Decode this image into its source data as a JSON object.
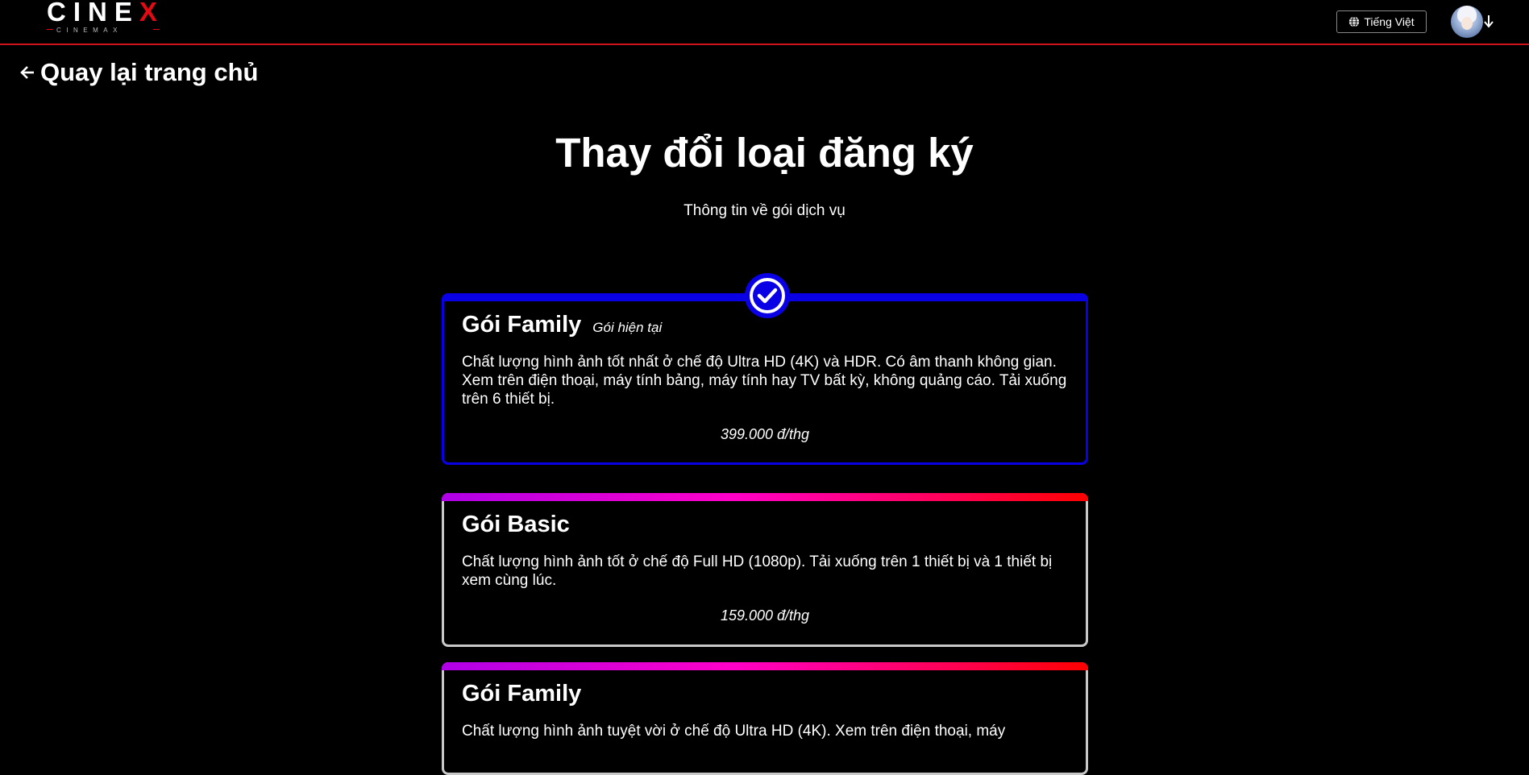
{
  "brand": {
    "name_main": "CINE",
    "name_accent": "X",
    "tagline": "CINEMAX",
    "accent_color": "#e50914"
  },
  "header": {
    "language_label": "Tiếng Việt",
    "language_icon": "globe-icon",
    "profile_caret_icon": "arrow-down-icon"
  },
  "back": {
    "label": "Quay lại trang chủ",
    "icon": "arrow-left-icon"
  },
  "page": {
    "title": "Thay đổi loại đăng ký",
    "subtitle": "Thông tin về gói dịch vụ"
  },
  "plans": [
    {
      "name": "Gói Family",
      "tag": "Gói hiện tại",
      "description": "Chất lượng hình ảnh tốt nhất ở chế độ Ultra HD (4K) và HDR. Có âm thanh không gian. Xem trên điện thoại, máy tính bảng, máy tính hay TV bất kỳ, không quảng cáo. Tải xuống trên 6 thiết bị.",
      "price": "399.000 đ/thg",
      "selected": true,
      "accent_color": "#0a00e6"
    },
    {
      "name": "Gói Basic",
      "tag": "",
      "description": "Chất lượng hình ảnh tốt ở chế độ Full HD (1080p). Tải xuống trên 1 thiết bị và 1 thiết bị xem cùng lúc.",
      "price": "159.000 đ/thg",
      "selected": false
    },
    {
      "name": "Gói Family",
      "tag": "",
      "description": "Chất lượng hình ảnh tuyệt vời ở chế độ Ultra HD (4K). Xem trên điện thoại, máy",
      "price": "",
      "selected": false
    }
  ]
}
